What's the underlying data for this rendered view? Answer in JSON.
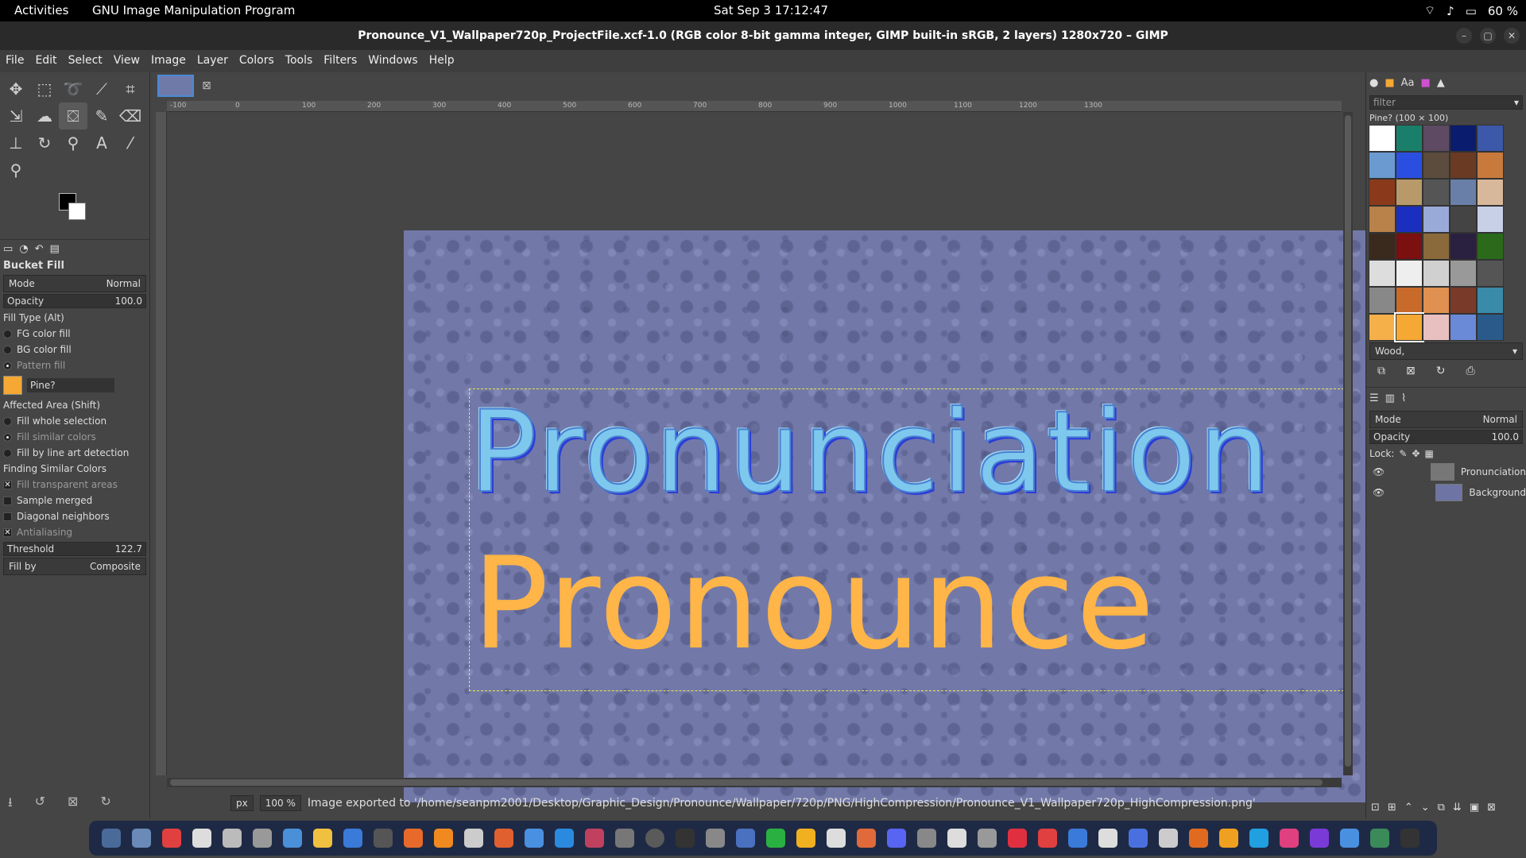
{
  "topbar": {
    "activities": "Activities",
    "app": "GNU Image Manipulation Program",
    "clock": "Sat Sep 3  17:12:47",
    "battery": "60 %"
  },
  "title": "Pronounce_V1_Wallpaper720p_ProjectFile.xcf-1.0 (RGB color 8-bit gamma integer, GIMP built-in sRGB, 2 layers) 1280x720 – GIMP",
  "menu": [
    "File",
    "Edit",
    "Select",
    "View",
    "Image",
    "Layer",
    "Colors",
    "Tools",
    "Filters",
    "Windows",
    "Help"
  ],
  "tool_options": {
    "title": "Bucket Fill",
    "mode_label": "Mode",
    "mode_value": "Normal",
    "opacity_label": "Opacity",
    "opacity_value": "100.0",
    "fill_type": "Fill Type  (Alt)",
    "fg": "FG color fill",
    "bg": "BG color fill",
    "pattern": "Pattern fill",
    "pattern_name": "Pine?",
    "affected": "Affected Area  (Shift)",
    "whole": "Fill whole selection",
    "similar": "Fill similar colors",
    "lineart": "Fill by line art detection",
    "finding": "Finding Similar Colors",
    "transparent": "Fill transparent areas",
    "merged": "Sample merged",
    "diagonal": "Diagonal neighbors",
    "antialias": "Antialiasing",
    "threshold_label": "Threshold",
    "threshold_value": "122.7",
    "fillby_label": "Fill by",
    "fillby_value": "Composite"
  },
  "canvas": {
    "line1": "Pronunciation",
    "line2": "Pronounce"
  },
  "ruler": [
    "-100",
    "0",
    "100",
    "200",
    "300",
    "400",
    "500",
    "600",
    "700",
    "800",
    "900",
    "1000",
    "1100",
    "1200",
    "1300"
  ],
  "status": {
    "unit": "px",
    "zoom": "100 %",
    "message": "Image exported to '/home/seanpm2001/Desktop/Graphic_Design/Pronounce/Wallpaper/720p/PNG/HighCompression/Pronounce_V1_Wallpaper720p_HighCompression.png'"
  },
  "patterns": {
    "filter": "filter",
    "current": "Pine? (100 × 100)",
    "tag": "Wood,"
  },
  "layers": {
    "mode_label": "Mode",
    "mode_value": "Normal",
    "opacity_label": "Opacity",
    "opacity_value": "100.0",
    "lock": "Lock:",
    "items": [
      "Pronunciation",
      "Background"
    ]
  }
}
